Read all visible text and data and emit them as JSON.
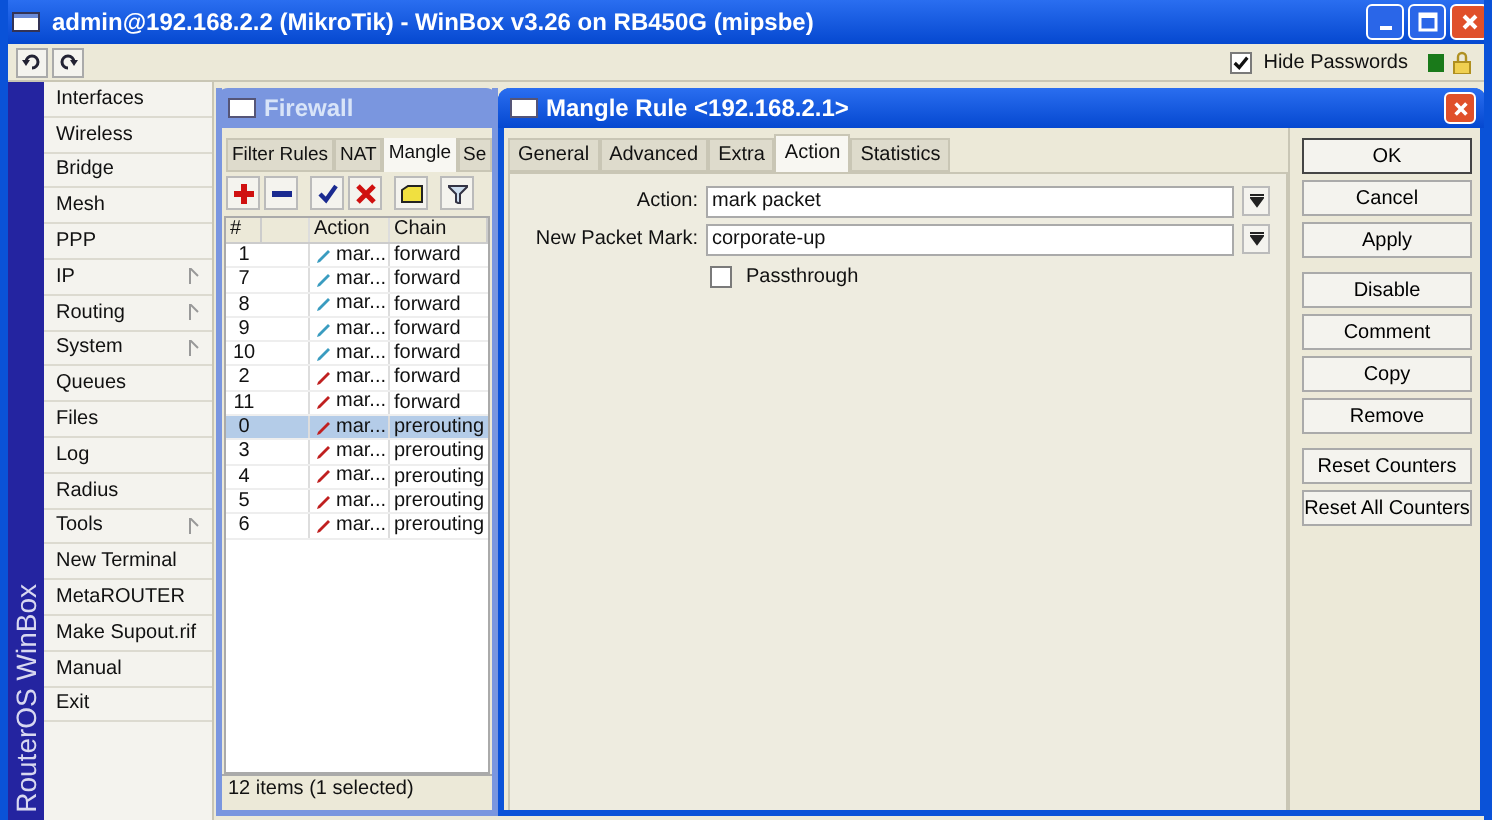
{
  "window": {
    "title": "admin@192.168.2.2 (MikroTik) - WinBox v3.26 on RB450G (mipsbe)"
  },
  "toolbar": {
    "hide_passwords": {
      "label": "Hide Passwords",
      "checked": true
    }
  },
  "side_label": "RouterOS WinBox",
  "sidebar": {
    "items": [
      {
        "label": "Interfaces",
        "submenu": false
      },
      {
        "label": "Wireless",
        "submenu": false
      },
      {
        "label": "Bridge",
        "submenu": false
      },
      {
        "label": "Mesh",
        "submenu": false
      },
      {
        "label": "PPP",
        "submenu": false
      },
      {
        "label": "IP",
        "submenu": true
      },
      {
        "label": "Routing",
        "submenu": true
      },
      {
        "label": "System",
        "submenu": true
      },
      {
        "label": "Queues",
        "submenu": false
      },
      {
        "label": "Files",
        "submenu": false
      },
      {
        "label": "Log",
        "submenu": false
      },
      {
        "label": "Radius",
        "submenu": false
      },
      {
        "label": "Tools",
        "submenu": true
      },
      {
        "label": "New Terminal",
        "submenu": false
      },
      {
        "label": "MetaROUTER",
        "submenu": false
      },
      {
        "label": "Make Supout.rif",
        "submenu": false
      },
      {
        "label": "Manual",
        "submenu": false
      },
      {
        "label": "Exit",
        "submenu": false
      }
    ]
  },
  "firewall": {
    "title": "Firewall",
    "tabs": [
      {
        "label": "Filter Rules",
        "selected": false
      },
      {
        "label": "NAT",
        "selected": false
      },
      {
        "label": "Mangle",
        "selected": true
      },
      {
        "label": "Se",
        "selected": false
      }
    ],
    "table": {
      "columns": [
        "#",
        "Action",
        "Chain"
      ],
      "rows": [
        {
          "num": "1",
          "action": "mar...",
          "chain": "forward",
          "color": "#3a9cc0",
          "selected": false
        },
        {
          "num": "7",
          "action": "mar...",
          "chain": "forward",
          "color": "#3a9cc0",
          "selected": false
        },
        {
          "num": "8",
          "action": "mar...",
          "chain": "forward",
          "color": "#3a9cc0",
          "selected": false
        },
        {
          "num": "9",
          "action": "mar...",
          "chain": "forward",
          "color": "#3a9cc0",
          "selected": false
        },
        {
          "num": "10",
          "action": "mar...",
          "chain": "forward",
          "color": "#3a9cc0",
          "selected": false
        },
        {
          "num": "2",
          "action": "mar...",
          "chain": "forward",
          "color": "#c02020",
          "selected": false
        },
        {
          "num": "11",
          "action": "mar...",
          "chain": "forward",
          "color": "#c02020",
          "selected": false
        },
        {
          "num": "0",
          "action": "mar...",
          "chain": "prerouting",
          "color": "#c02020",
          "selected": true
        },
        {
          "num": "3",
          "action": "mar...",
          "chain": "prerouting",
          "color": "#c02020",
          "selected": false
        },
        {
          "num": "4",
          "action": "mar...",
          "chain": "prerouting",
          "color": "#c02020",
          "selected": false
        },
        {
          "num": "5",
          "action": "mar...",
          "chain": "prerouting",
          "color": "#c02020",
          "selected": false
        },
        {
          "num": "6",
          "action": "mar...",
          "chain": "prerouting",
          "color": "#c02020",
          "selected": false
        }
      ]
    },
    "status_bar": "12 items (1 selected)"
  },
  "mangle_rule": {
    "title": "Mangle Rule <192.168.2.1>",
    "tabs": [
      {
        "label": "General",
        "selected": false
      },
      {
        "label": "Advanced",
        "selected": false
      },
      {
        "label": "Extra",
        "selected": false
      },
      {
        "label": "Action",
        "selected": true
      },
      {
        "label": "Statistics",
        "selected": false
      }
    ],
    "fields": [
      {
        "label": "Action:",
        "value": "mark packet"
      },
      {
        "label": "New Packet Mark:",
        "value": "corporate-up"
      }
    ],
    "passthrough": {
      "label": "Passthrough",
      "checked": false
    },
    "button_groups": [
      [
        "OK",
        "Cancel",
        "Apply"
      ],
      [
        "Disable",
        "Comment",
        "Copy",
        "Remove"
      ],
      [
        "Reset Counters",
        "Reset All Counters"
      ]
    ]
  }
}
